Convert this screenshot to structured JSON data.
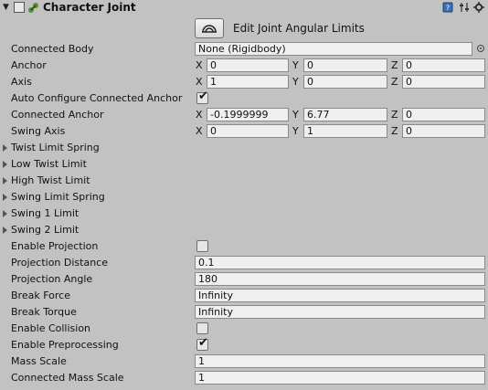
{
  "component": {
    "title": "Character Joint",
    "edit_limits_label": "Edit Joint Angular Limits"
  },
  "props": {
    "connected_body": {
      "label": "Connected Body",
      "value": "None (Rigidbody)"
    },
    "anchor": {
      "label": "Anchor",
      "x": "0",
      "y": "0",
      "z": "0"
    },
    "axis": {
      "label": "Axis",
      "x": "1",
      "y": "0",
      "z": "0"
    },
    "auto_configure": {
      "label": "Auto Configure Connected Anchor",
      "checked": true
    },
    "connected_anchor": {
      "label": "Connected Anchor",
      "x": "-0.1999999",
      "y": "6.77",
      "z": "0"
    },
    "swing_axis": {
      "label": "Swing Axis",
      "x": "0",
      "y": "1",
      "z": "0"
    },
    "twist_limit_spring": {
      "label": "Twist Limit Spring"
    },
    "low_twist_limit": {
      "label": "Low Twist Limit"
    },
    "high_twist_limit": {
      "label": "High Twist Limit"
    },
    "swing_limit_spring": {
      "label": "Swing Limit Spring"
    },
    "swing1_limit": {
      "label": "Swing 1 Limit"
    },
    "swing2_limit": {
      "label": "Swing 2 Limit"
    },
    "enable_projection": {
      "label": "Enable Projection",
      "checked": false
    },
    "projection_distance": {
      "label": "Projection Distance",
      "value": "0.1"
    },
    "projection_angle": {
      "label": "Projection Angle",
      "value": "180"
    },
    "break_force": {
      "label": "Break Force",
      "value": "Infinity"
    },
    "break_torque": {
      "label": "Break Torque",
      "value": "Infinity"
    },
    "enable_collision": {
      "label": "Enable Collision",
      "checked": false
    },
    "enable_preprocessing": {
      "label": "Enable Preprocessing",
      "checked": true
    },
    "mass_scale": {
      "label": "Mass Scale",
      "value": "1"
    },
    "connected_mass_scale": {
      "label": "Connected Mass Scale",
      "value": "1"
    }
  },
  "axis_letters": {
    "x": "X",
    "y": "Y",
    "z": "Z"
  },
  "icons": {
    "foldout": "triangle-down-icon",
    "component": "character-joint-icon",
    "help": "help-book-icon",
    "presets": "presets-icon",
    "settings": "gear-icon",
    "edit_limits": "joint-angular-limits-icon",
    "object_picker": "object-picker-icon"
  },
  "checkmark": "✔"
}
